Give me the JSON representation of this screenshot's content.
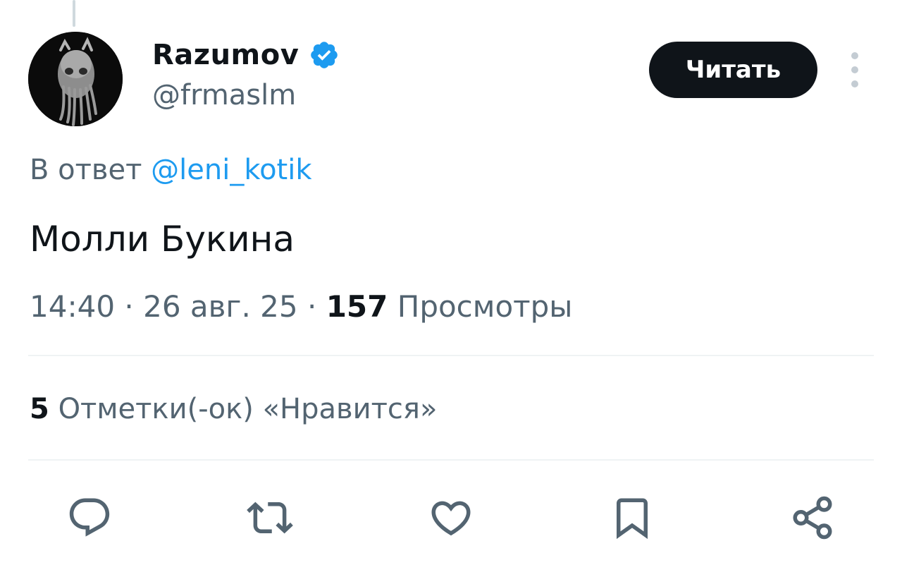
{
  "user": {
    "display_name": "Razumov",
    "handle": "@frmaslm",
    "verified": true
  },
  "follow_button": {
    "label": "Читать"
  },
  "reply": {
    "prefix": "В ответ",
    "mention": "@leni_kotik"
  },
  "tweet": {
    "text": "Молли Букина",
    "time": "14:40",
    "separator": "·",
    "date": "26 авг. 25",
    "views_count": "157",
    "views_label": "Просмотры"
  },
  "likes": {
    "count": "5",
    "label": "Отметки(-ок) «Нравится»"
  },
  "actions": [
    {
      "icon": "reply-icon"
    },
    {
      "icon": "retweet-icon"
    },
    {
      "icon": "like-icon"
    },
    {
      "icon": "bookmark-icon"
    },
    {
      "icon": "share-icon"
    }
  ],
  "colors": {
    "text_primary": "#0f1419",
    "text_secondary": "#536471",
    "link": "#1d9bf0",
    "verified": "#1d9bf0",
    "divider": "#eff3f4"
  }
}
